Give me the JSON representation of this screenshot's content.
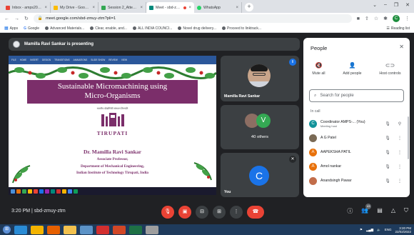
{
  "browser": {
    "tabs": [
      {
        "title": "Inbox - amps20gpn@gmail.co",
        "color": "#ea4335",
        "active": false
      },
      {
        "title": "My Drive - Google Drive",
        "color": "#fbbc04",
        "active": false
      },
      {
        "title": "Session 2_Attendance Day -2",
        "color": "#34a853",
        "active": false
      },
      {
        "title": "Meet - sbd-zmuy-ztm",
        "color": "#00897b",
        "active": true
      },
      {
        "title": "WhatsApp",
        "color": "#25d366",
        "active": false
      }
    ],
    "new_tab": "+",
    "address": "meet.google.com/sbd-zmuy-ztm?pli=1",
    "profile_initial": "C",
    "bookmarks": [
      "Apps",
      "Google",
      "Advanced Materials...",
      "Clear, enable, and...",
      "ALL INDIA COUNCI...",
      "Novel drug delivery...",
      "Proceed to linktrack..."
    ],
    "reading_list": "Reading list"
  },
  "meet": {
    "presenting_text": "Mamilla Ravi Sankar is presenting",
    "slide": {
      "ribbon_items": [
        "FILE",
        "HOME",
        "INSERT",
        "DESIGN",
        "TRANSITIONS",
        "ANIMATIONS",
        "SLIDE SHOW",
        "REVIEW",
        "VIEW"
      ],
      "title_line1": "Sustainable Micromachining using",
      "title_line2": "Micro-Organisms",
      "hindi": "भारतीय प्रौद्योगिकी संस्थान तिरुपति",
      "institute_short": "TIRUPATI",
      "presenter": "Dr. Mamilla Ravi Sankar",
      "role": "Associate Professor,",
      "dept": "Department of Mechanical Engineering,",
      "institute": "Indian Institute of Technology Tirupati, India"
    },
    "tiles": {
      "self_name": "Mamilla Ravi Sankar",
      "others_initial": "V",
      "others_count": "40 others",
      "you_initial": "C",
      "you_label": "You"
    },
    "people": {
      "title": "People",
      "actions": [
        "Mute all",
        "Add people",
        "Host controls"
      ],
      "search_placeholder": "Search for people",
      "section": "In call",
      "list": [
        {
          "initial": "C",
          "name": "Coordinator AMPS-... (You)",
          "sub": "Meeting host",
          "color": "#12939a"
        },
        {
          "initial": "",
          "name": "A G Patel",
          "sub": "",
          "color": "#7a6a55"
        },
        {
          "initial": "A",
          "name": "AAPEKSHA PATIL",
          "sub": "",
          "color": "#e8710a"
        },
        {
          "initial": "A",
          "name": "Amol nankar",
          "sub": "",
          "color": "#e8710a"
        },
        {
          "initial": "",
          "name": "Anandsingh Pawar",
          "sub": "",
          "color": "#c26d4a"
        }
      ]
    },
    "bottom": {
      "timecode": "3:20 PM  |  sbd-zmuy-ztm",
      "participants_badge": "43"
    }
  },
  "taskbar": {
    "time": "3:20 PM",
    "date": "22/02/2022",
    "lang": "ENG"
  }
}
